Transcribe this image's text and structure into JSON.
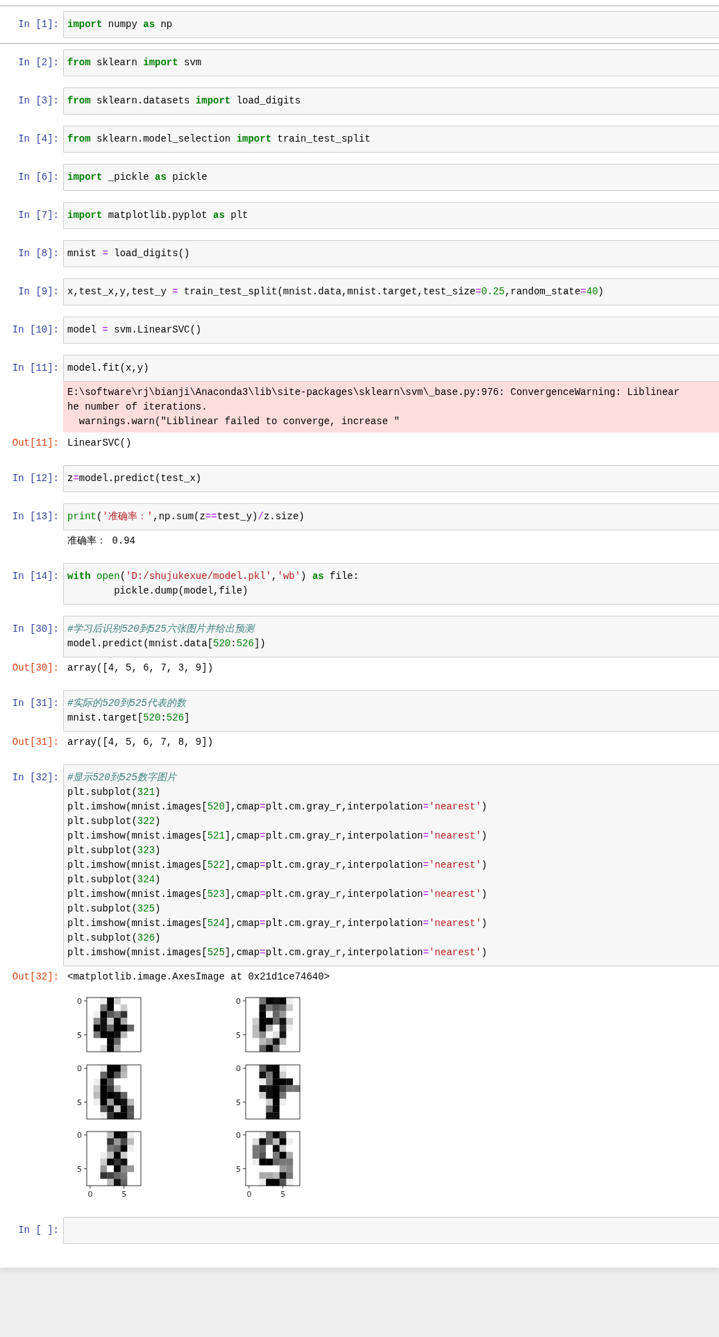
{
  "cells": [
    {
      "prompt": "In [1]:",
      "selected": true,
      "lines": [
        [
          {
            "kind": "keyword",
            "text": "import"
          },
          {
            "kind": "plain",
            "text": " numpy "
          },
          {
            "kind": "keyword",
            "text": "as"
          },
          {
            "kind": "plain",
            "text": " np"
          }
        ]
      ]
    },
    {
      "prompt": "In [2]:",
      "selected": false,
      "lines": [
        [
          {
            "kind": "keyword",
            "text": "from"
          },
          {
            "kind": "plain",
            "text": " sklearn "
          },
          {
            "kind": "keyword",
            "text": "import"
          },
          {
            "kind": "plain",
            "text": " svm"
          }
        ]
      ]
    },
    {
      "prompt": "In [3]:",
      "selected": false,
      "lines": [
        [
          {
            "kind": "keyword",
            "text": "from"
          },
          {
            "kind": "plain",
            "text": " sklearn.datasets "
          },
          {
            "kind": "keyword",
            "text": "import"
          },
          {
            "kind": "plain",
            "text": " load_digits"
          }
        ]
      ]
    },
    {
      "prompt": "In [4]:",
      "selected": false,
      "lines": [
        [
          {
            "kind": "keyword",
            "text": "from"
          },
          {
            "kind": "plain",
            "text": " sklearn.model_selection "
          },
          {
            "kind": "keyword",
            "text": "import"
          },
          {
            "kind": "plain",
            "text": " train_test_split"
          }
        ]
      ]
    },
    {
      "prompt": "In [6]:",
      "selected": false,
      "lines": [
        [
          {
            "kind": "keyword",
            "text": "import"
          },
          {
            "kind": "plain",
            "text": " _pickle "
          },
          {
            "kind": "keyword",
            "text": "as"
          },
          {
            "kind": "plain",
            "text": " pickle"
          }
        ]
      ]
    },
    {
      "prompt": "In [7]:",
      "selected": false,
      "lines": [
        [
          {
            "kind": "keyword",
            "text": "import"
          },
          {
            "kind": "plain",
            "text": " matplotlib.pyplot "
          },
          {
            "kind": "keyword",
            "text": "as"
          },
          {
            "kind": "plain",
            "text": " plt"
          }
        ]
      ]
    },
    {
      "prompt": "In [8]:",
      "selected": false,
      "lines": [
        [
          {
            "kind": "plain",
            "text": "mnist "
          },
          {
            "kind": "op",
            "text": "="
          },
          {
            "kind": "plain",
            "text": " load_digits()"
          }
        ]
      ]
    },
    {
      "prompt": "In [9]:",
      "selected": false,
      "lines": [
        [
          {
            "kind": "plain",
            "text": "x,test_x,y,test_y "
          },
          {
            "kind": "op",
            "text": "="
          },
          {
            "kind": "plain",
            "text": " train_test_split(mnist.data,mnist.target,test_size"
          },
          {
            "kind": "op",
            "text": "="
          },
          {
            "kind": "num",
            "text": "0.25"
          },
          {
            "kind": "plain",
            "text": ",random_state"
          },
          {
            "kind": "op",
            "text": "="
          },
          {
            "kind": "num",
            "text": "40"
          },
          {
            "kind": "plain",
            "text": ")"
          }
        ]
      ]
    },
    {
      "prompt": "In [10]:",
      "selected": false,
      "lines": [
        [
          {
            "kind": "plain",
            "text": "model "
          },
          {
            "kind": "op",
            "text": "="
          },
          {
            "kind": "plain",
            "text": " svm.LinearSVC()"
          }
        ]
      ]
    },
    {
      "prompt": "In [11]:",
      "selected": false,
      "lines": [
        [
          {
            "kind": "plain",
            "text": "model.fit(x,y)"
          }
        ]
      ],
      "outputs": [
        {
          "kind": "stderr",
          "lines": [
            "E:\\software\\rj\\bianji\\Anaconda3\\lib\\site-packages\\sklearn\\svm\\_base.py:976: ConvergenceWarning: Liblinear",
            "he number of iterations.",
            "  warnings.warn(\"Liblinear failed to converge, increase \""
          ]
        },
        {
          "kind": "result",
          "prompt": "Out[11]:",
          "text": "LinearSVC()"
        }
      ]
    },
    {
      "prompt": "In [12]:",
      "selected": false,
      "lines": [
        [
          {
            "kind": "plain",
            "text": "z"
          },
          {
            "kind": "op",
            "text": "="
          },
          {
            "kind": "plain",
            "text": "model.predict(test_x)"
          }
        ]
      ]
    },
    {
      "prompt": "In [13]:",
      "selected": false,
      "lines": [
        [
          {
            "kind": "builtin",
            "text": "print"
          },
          {
            "kind": "plain",
            "text": "("
          },
          {
            "kind": "str",
            "text": "'准确率：'"
          },
          {
            "kind": "plain",
            "text": ",np.sum(z"
          },
          {
            "kind": "op",
            "text": "=="
          },
          {
            "kind": "plain",
            "text": "test_y)"
          },
          {
            "kind": "op",
            "text": "/"
          },
          {
            "kind": "plain",
            "text": "z.size)"
          }
        ]
      ],
      "outputs": [
        {
          "kind": "stream",
          "text": "准确率： 0.94"
        }
      ]
    },
    {
      "prompt": "In [14]:",
      "selected": false,
      "lines": [
        [
          {
            "kind": "keyword",
            "text": "with"
          },
          {
            "kind": "builtin",
            "text": " open"
          },
          {
            "kind": "plain",
            "text": "("
          },
          {
            "kind": "str",
            "text": "'D:/shujukexue/model.pkl'"
          },
          {
            "kind": "plain",
            "text": ","
          },
          {
            "kind": "str",
            "text": "'wb'"
          },
          {
            "kind": "plain",
            "text": ") "
          },
          {
            "kind": "keyword",
            "text": "as"
          },
          {
            "kind": "plain",
            "text": " file:"
          }
        ],
        [
          {
            "kind": "plain",
            "text": "        pickle.dump(model,file)"
          }
        ]
      ]
    },
    {
      "prompt": "In [30]:",
      "selected": false,
      "lines": [
        [
          {
            "kind": "comment",
            "text": "#学习后识别520到525六张图片并给出预测"
          }
        ],
        [
          {
            "kind": "plain",
            "text": "model.predict(mnist.data["
          },
          {
            "kind": "num",
            "text": "520"
          },
          {
            "kind": "plain",
            "text": ":"
          },
          {
            "kind": "num",
            "text": "526"
          },
          {
            "kind": "plain",
            "text": "])"
          }
        ]
      ],
      "outputs": [
        {
          "kind": "result",
          "prompt": "Out[30]:",
          "text": "array([4, 5, 6, 7, 3, 9])"
        }
      ]
    },
    {
      "prompt": "In [31]:",
      "selected": false,
      "lines": [
        [
          {
            "kind": "comment",
            "text": "#实际的520到525代表的数"
          }
        ],
        [
          {
            "kind": "plain",
            "text": "mnist.target["
          },
          {
            "kind": "num",
            "text": "520"
          },
          {
            "kind": "plain",
            "text": ":"
          },
          {
            "kind": "num",
            "text": "526"
          },
          {
            "kind": "plain",
            "text": "]"
          }
        ]
      ],
      "outputs": [
        {
          "kind": "result",
          "prompt": "Out[31]:",
          "text": "array([4, 5, 6, 7, 8, 9])"
        }
      ]
    },
    {
      "prompt": "In [32]:",
      "selected": false,
      "lines": [
        [
          {
            "kind": "comment",
            "text": "#显示520到525数字图片"
          }
        ],
        [
          {
            "kind": "plain",
            "text": "plt.subplot("
          },
          {
            "kind": "num",
            "text": "321"
          },
          {
            "kind": "plain",
            "text": ")"
          }
        ],
        [
          {
            "kind": "plain",
            "text": "plt.imshow(mnist.images["
          },
          {
            "kind": "num",
            "text": "520"
          },
          {
            "kind": "plain",
            "text": "],cmap"
          },
          {
            "kind": "op",
            "text": "="
          },
          {
            "kind": "plain",
            "text": "plt.cm.gray_r,interpolation"
          },
          {
            "kind": "op",
            "text": "="
          },
          {
            "kind": "str",
            "text": "'nearest'"
          },
          {
            "kind": "plain",
            "text": ")"
          }
        ],
        [
          {
            "kind": "plain",
            "text": "plt.subplot("
          },
          {
            "kind": "num",
            "text": "322"
          },
          {
            "kind": "plain",
            "text": ")"
          }
        ],
        [
          {
            "kind": "plain",
            "text": "plt.imshow(mnist.images["
          },
          {
            "kind": "num",
            "text": "521"
          },
          {
            "kind": "plain",
            "text": "],cmap"
          },
          {
            "kind": "op",
            "text": "="
          },
          {
            "kind": "plain",
            "text": "plt.cm.gray_r,interpolation"
          },
          {
            "kind": "op",
            "text": "="
          },
          {
            "kind": "str",
            "text": "'nearest'"
          },
          {
            "kind": "plain",
            "text": ")"
          }
        ],
        [
          {
            "kind": "plain",
            "text": "plt.subplot("
          },
          {
            "kind": "num",
            "text": "323"
          },
          {
            "kind": "plain",
            "text": ")"
          }
        ],
        [
          {
            "kind": "plain",
            "text": "plt.imshow(mnist.images["
          },
          {
            "kind": "num",
            "text": "522"
          },
          {
            "kind": "plain",
            "text": "],cmap"
          },
          {
            "kind": "op",
            "text": "="
          },
          {
            "kind": "plain",
            "text": "plt.cm.gray_r,interpolation"
          },
          {
            "kind": "op",
            "text": "="
          },
          {
            "kind": "str",
            "text": "'nearest'"
          },
          {
            "kind": "plain",
            "text": ")"
          }
        ],
        [
          {
            "kind": "plain",
            "text": "plt.subplot("
          },
          {
            "kind": "num",
            "text": "324"
          },
          {
            "kind": "plain",
            "text": ")"
          }
        ],
        [
          {
            "kind": "plain",
            "text": "plt.imshow(mnist.images["
          },
          {
            "kind": "num",
            "text": "523"
          },
          {
            "kind": "plain",
            "text": "],cmap"
          },
          {
            "kind": "op",
            "text": "="
          },
          {
            "kind": "plain",
            "text": "plt.cm.gray_r,interpolation"
          },
          {
            "kind": "op",
            "text": "="
          },
          {
            "kind": "str",
            "text": "'nearest'"
          },
          {
            "kind": "plain",
            "text": ")"
          }
        ],
        [
          {
            "kind": "plain",
            "text": "plt.subplot("
          },
          {
            "kind": "num",
            "text": "325"
          },
          {
            "kind": "plain",
            "text": ")"
          }
        ],
        [
          {
            "kind": "plain",
            "text": "plt.imshow(mnist.images["
          },
          {
            "kind": "num",
            "text": "524"
          },
          {
            "kind": "plain",
            "text": "],cmap"
          },
          {
            "kind": "op",
            "text": "="
          },
          {
            "kind": "plain",
            "text": "plt.cm.gray_r,interpolation"
          },
          {
            "kind": "op",
            "text": "="
          },
          {
            "kind": "str",
            "text": "'nearest'"
          },
          {
            "kind": "plain",
            "text": ")"
          }
        ],
        [
          {
            "kind": "plain",
            "text": "plt.subplot("
          },
          {
            "kind": "num",
            "text": "326"
          },
          {
            "kind": "plain",
            "text": ")"
          }
        ],
        [
          {
            "kind": "plain",
            "text": "plt.imshow(mnist.images["
          },
          {
            "kind": "num",
            "text": "525"
          },
          {
            "kind": "plain",
            "text": "],cmap"
          },
          {
            "kind": "op",
            "text": "="
          },
          {
            "kind": "plain",
            "text": "plt.cm.gray_r,interpolation"
          },
          {
            "kind": "op",
            "text": "="
          },
          {
            "kind": "str",
            "text": "'nearest'"
          },
          {
            "kind": "plain",
            "text": ")"
          }
        ]
      ],
      "outputs": [
        {
          "kind": "result",
          "prompt": "Out[32]:",
          "text": "<matplotlib.image.AxesImage at 0x21d1ce74640>"
        },
        {
          "kind": "figure",
          "subplots": [
            {
              "yticks": [
                "0",
                "5"
              ]
            },
            {
              "yticks": [
                "0",
                "5"
              ]
            },
            {
              "yticks": [
                "0",
                "5"
              ]
            },
            {
              "yticks": [
                "0",
                "5"
              ]
            },
            {
              "yticks": [
                "0",
                "5"
              ],
              "xticks": [
                "0",
                "5"
              ]
            },
            {
              "yticks": [
                "0",
                "5"
              ],
              "xticks": [
                "0",
                "5"
              ]
            }
          ]
        }
      ]
    },
    {
      "prompt": "In [ ]:",
      "selected": false
    }
  ]
}
